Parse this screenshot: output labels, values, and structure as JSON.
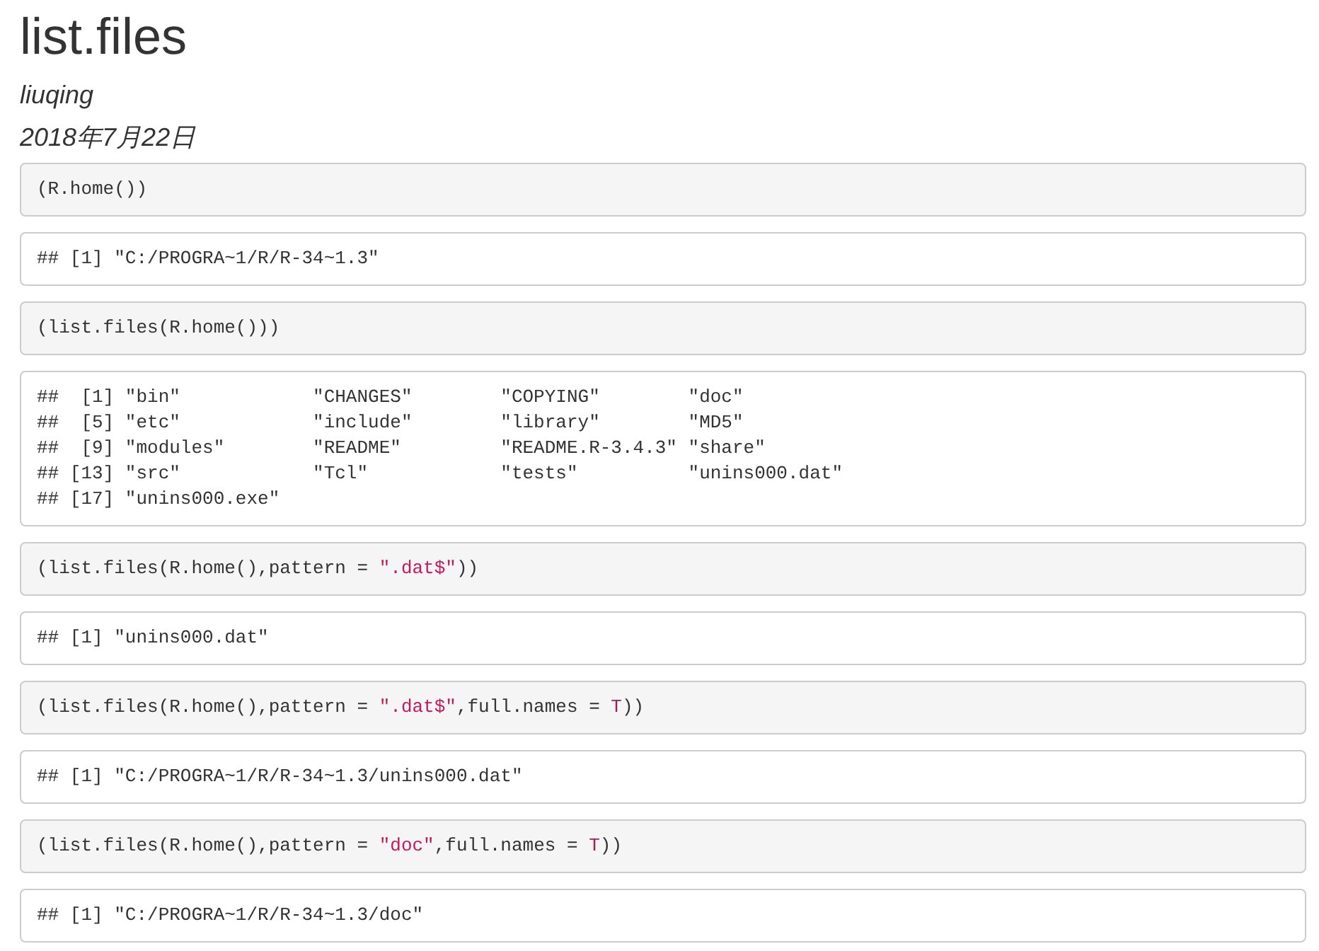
{
  "title": "list.files",
  "author": "liuqing",
  "date": "2018年7月22日",
  "blocks": [
    {
      "kind": "source",
      "segments": [
        {
          "kind": "plain",
          "text": "(R.home())"
        }
      ]
    },
    {
      "kind": "output",
      "lines": [
        "## [1] \"C:/PROGRA~1/R/R-34~1.3\""
      ]
    },
    {
      "kind": "source",
      "segments": [
        {
          "kind": "plain",
          "text": "(list.files(R.home()))"
        }
      ]
    },
    {
      "kind": "output",
      "lines": [
        "##  [1] \"bin\"            \"CHANGES\"        \"COPYING\"        \"doc\"",
        "##  [5] \"etc\"            \"include\"        \"library\"        \"MD5\"",
        "##  [9] \"modules\"        \"README\"         \"README.R-3.4.3\" \"share\"",
        "## [13] \"src\"            \"Tcl\"            \"tests\"          \"unins000.dat\"",
        "## [17] \"unins000.exe\""
      ]
    },
    {
      "kind": "source",
      "segments": [
        {
          "kind": "plain",
          "text": "(list.files(R.home(),pattern = "
        },
        {
          "kind": "string",
          "text": "\".dat$\""
        },
        {
          "kind": "plain",
          "text": "))"
        }
      ]
    },
    {
      "kind": "output",
      "lines": [
        "## [1] \"unins000.dat\""
      ]
    },
    {
      "kind": "source",
      "segments": [
        {
          "kind": "plain",
          "text": "(list.files(R.home(),pattern = "
        },
        {
          "kind": "string",
          "text": "\".dat$\""
        },
        {
          "kind": "plain",
          "text": ",full.names = "
        },
        {
          "kind": "constant",
          "text": "T"
        },
        {
          "kind": "plain",
          "text": "))"
        }
      ]
    },
    {
      "kind": "output",
      "lines": [
        "## [1] \"C:/PROGRA~1/R/R-34~1.3/unins000.dat\""
      ]
    },
    {
      "kind": "source",
      "segments": [
        {
          "kind": "plain",
          "text": "(list.files(R.home(),pattern = "
        },
        {
          "kind": "string",
          "text": "\"doc\""
        },
        {
          "kind": "plain",
          "text": ",full.names = "
        },
        {
          "kind": "constant",
          "text": "T"
        },
        {
          "kind": "plain",
          "text": "))"
        }
      ]
    },
    {
      "kind": "output",
      "lines": [
        "## [1] \"C:/PROGRA~1/R/R-34~1.3/doc\""
      ]
    }
  ]
}
